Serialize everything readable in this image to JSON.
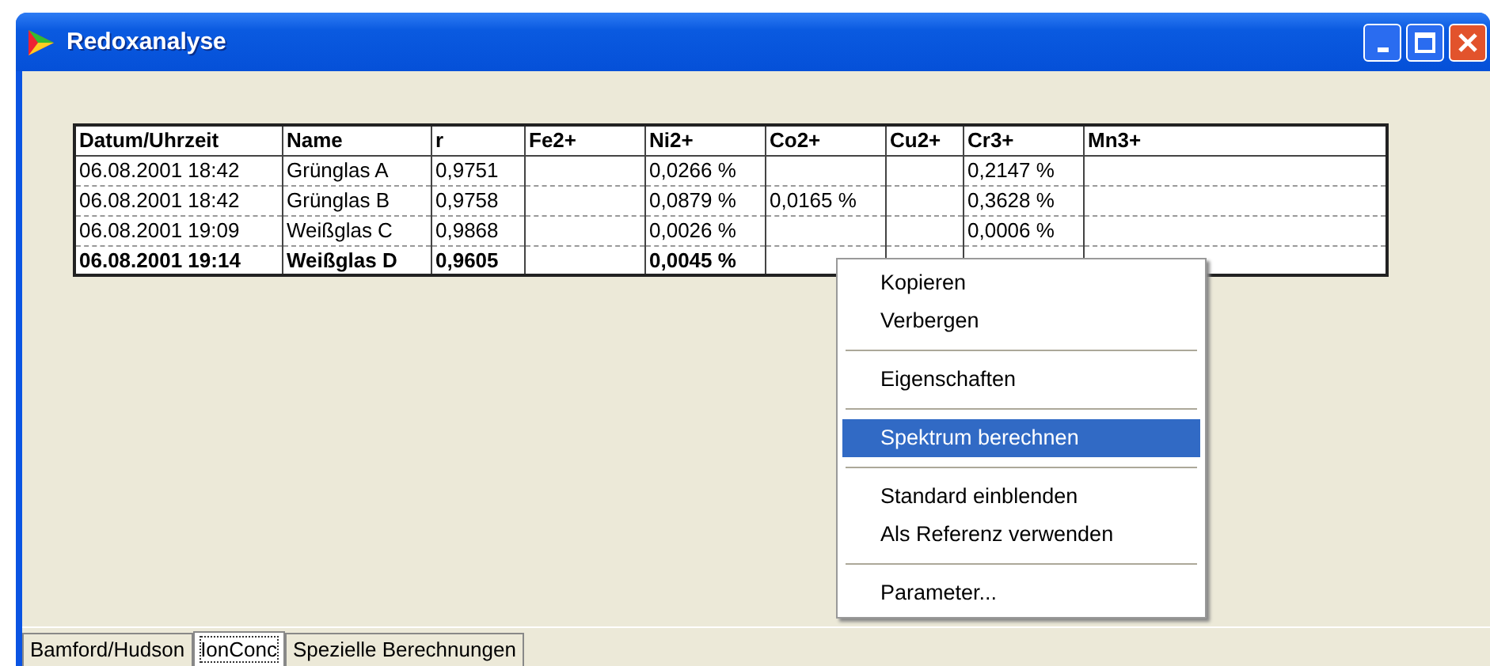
{
  "window": {
    "title": "Redoxanalyse"
  },
  "table": {
    "columns": [
      "Datum/Uhrzeit",
      "Name",
      "r",
      "Fe2+",
      "Ni2+",
      "Co2+",
      "Cu2+",
      "Cr3+",
      "Mn3+"
    ],
    "rows": [
      {
        "selected": false,
        "datum": "06.08.2001 18:42",
        "name": "Grünglas A",
        "r": "0,9751",
        "ni": "0,0266 %",
        "cr": "0,2147 %"
      },
      {
        "selected": false,
        "datum": "06.08.2001 18:42",
        "name": "Grünglas B",
        "r": "0,9758",
        "ni": "0,0879 %",
        "co": "0,0165 %",
        "cr": "0,3628 %"
      },
      {
        "selected": false,
        "datum": "06.08.2001 19:09",
        "name": "Weißglas C",
        "r": "0,9868",
        "ni": "0,0026 %",
        "cr": "0,0006 %"
      },
      {
        "selected": true,
        "datum": "06.08.2001 19:14",
        "name": "Weißglas D",
        "r": "0,9605",
        "ni": "0,0045 %"
      }
    ]
  },
  "context_menu": {
    "items": [
      {
        "kind": "item",
        "label": "Kopieren",
        "selected": false
      },
      {
        "kind": "item",
        "label": "Verbergen",
        "selected": false
      },
      {
        "kind": "separator"
      },
      {
        "kind": "item",
        "label": "Eigenschaften",
        "selected": false
      },
      {
        "kind": "separator"
      },
      {
        "kind": "item",
        "label": "Spektrum berechnen",
        "selected": true
      },
      {
        "kind": "separator"
      },
      {
        "kind": "item",
        "label": "Standard einblenden",
        "selected": false
      },
      {
        "kind": "item",
        "label": "Als Referenz verwenden",
        "selected": false
      },
      {
        "kind": "separator"
      },
      {
        "kind": "item",
        "label": "Parameter...",
        "selected": false
      }
    ]
  },
  "tabs": [
    {
      "label": "Bamford/Hudson",
      "selected": false
    },
    {
      "label": "IonConc",
      "selected": true
    },
    {
      "label": "Spezielle Berechnungen",
      "selected": false
    }
  ]
}
